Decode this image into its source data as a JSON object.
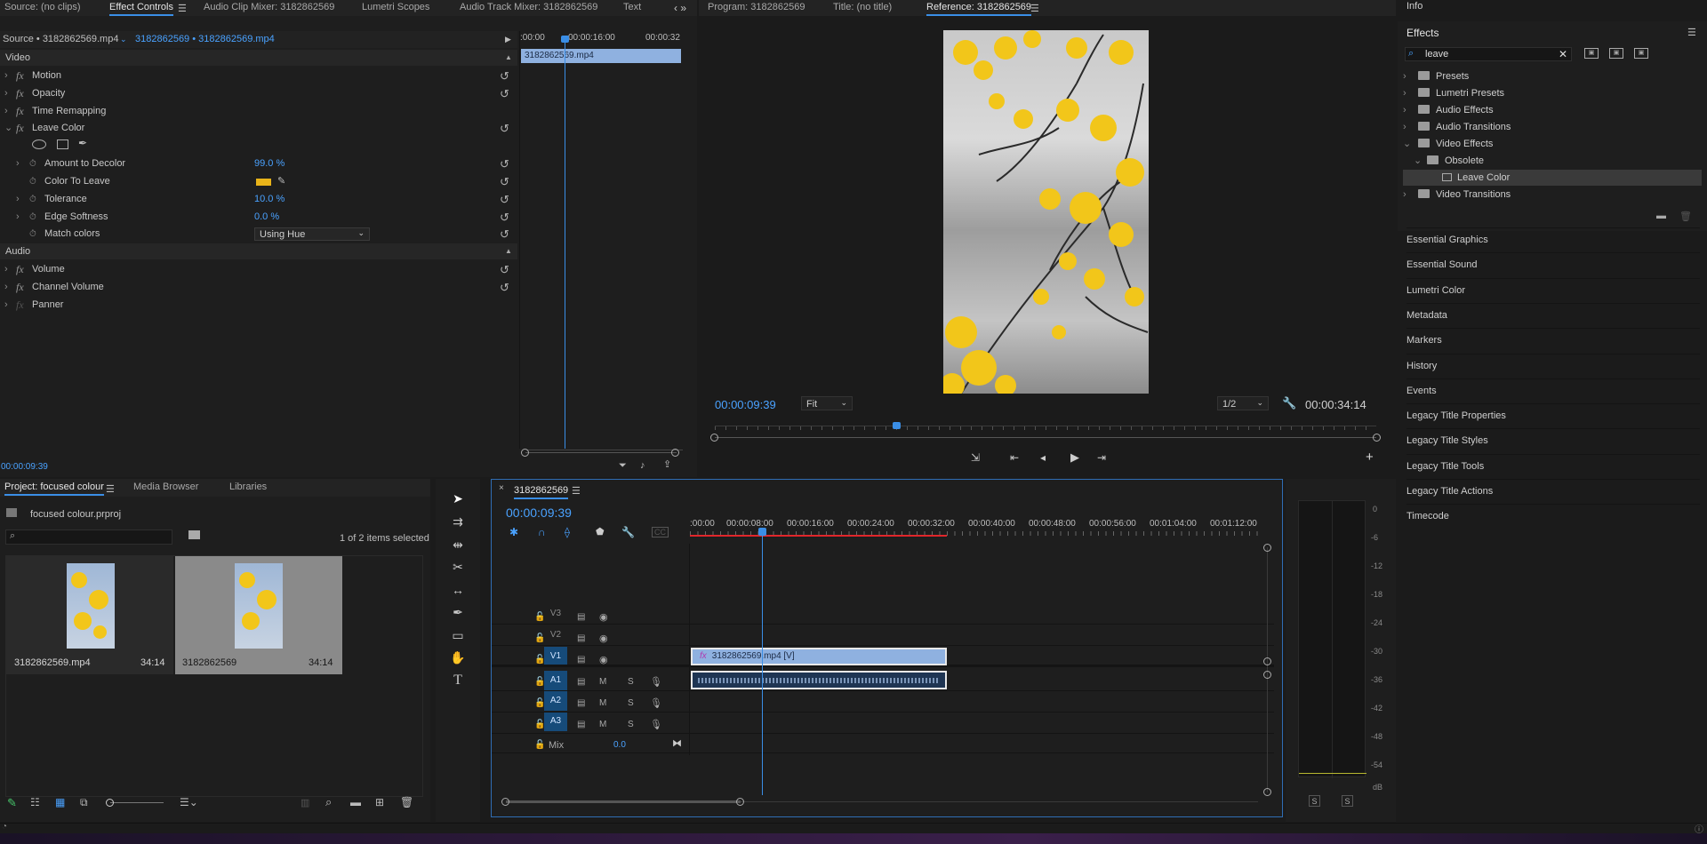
{
  "effect_controls": {
    "tabs": [
      "Source: (no clips)",
      "Effect Controls",
      "Audio Clip Mixer: 3182862569",
      "Lumetri Scopes",
      "Audio Track Mixer: 3182862569",
      "Text"
    ],
    "source_label": "Source • 3182862569.mp4",
    "clip_label": "3182862569 • 3182862569.mp4",
    "mini_ruler": [
      ":00:00",
      "00:00:16:00",
      "00:00:32"
    ],
    "mini_clip": "3182862569.mp4",
    "video_header": "Video",
    "motion": "Motion",
    "opacity": "Opacity",
    "time_remap": "Time Remapping",
    "leave_color": "Leave Color",
    "amount_label": "Amount to Decolor",
    "amount_value": "99.0 %",
    "color_label": "Color To Leave",
    "swatch_color": "#e8b319",
    "tolerance_label": "Tolerance",
    "tolerance_value": "10.0 %",
    "softness_label": "Edge Softness",
    "softness_value": "0.0 %",
    "match_label": "Match colors",
    "match_value": "Using Hue",
    "audio_header": "Audio",
    "volume": "Volume",
    "channel_volume": "Channel Volume",
    "panner": "Panner",
    "timecode": "00:00:09:39"
  },
  "monitor": {
    "tabs": [
      "Program: 3182862569",
      "Title: (no title)",
      "Reference: 3182862569"
    ],
    "timecode": "00:00:09:39",
    "fit": "Fit",
    "resolution": "1/2",
    "duration": "00:00:34:14"
  },
  "effects": {
    "info_tab": "Info",
    "title": "Effects",
    "search": "leave",
    "items": [
      "Presets",
      "Lumetri Presets",
      "Audio Effects",
      "Audio Transitions",
      "Video Effects",
      "Obsolete",
      "Leave Color",
      "Video Transitions"
    ],
    "panels": [
      "Essential Graphics",
      "Essential Sound",
      "Lumetri Color",
      "Metadata",
      "Markers",
      "History",
      "Events",
      "Legacy Title Properties",
      "Legacy Title Styles",
      "Legacy Title Tools",
      "Legacy Title Actions",
      "Timecode"
    ]
  },
  "project": {
    "tabs": [
      "Project: focused colour",
      "Media Browser",
      "Libraries"
    ],
    "file": "focused colour.prproj",
    "selection": "1 of 2 items selected",
    "items": [
      {
        "name": "3182862569.mp4",
        "duration": "34:14"
      },
      {
        "name": "3182862569",
        "duration": "34:14"
      }
    ]
  },
  "timeline": {
    "sequence": "3182862569",
    "timecode": "00:00:09:39",
    "ruler": [
      ":00:00",
      "00:00:08:00",
      "00:00:16:00",
      "00:00:24:00",
      "00:00:32:00",
      "00:00:40:00",
      "00:00:48:00",
      "00:00:56:00",
      "00:01:04:00",
      "00:01:12:00"
    ],
    "tracks": [
      "V3",
      "V2",
      "V1",
      "A1",
      "A2",
      "A3"
    ],
    "mix_label": "Mix",
    "mix_value": "0.0",
    "video_clip": "3182862569.mp4 [V]",
    "m_label": "M",
    "s_label": "S"
  },
  "meter": {
    "scale": [
      "0",
      "-6",
      "-12",
      "-18",
      "-24",
      "-30",
      "-36",
      "-42",
      "-48",
      "-54",
      "dB"
    ],
    "solo": [
      "S",
      "S"
    ]
  }
}
